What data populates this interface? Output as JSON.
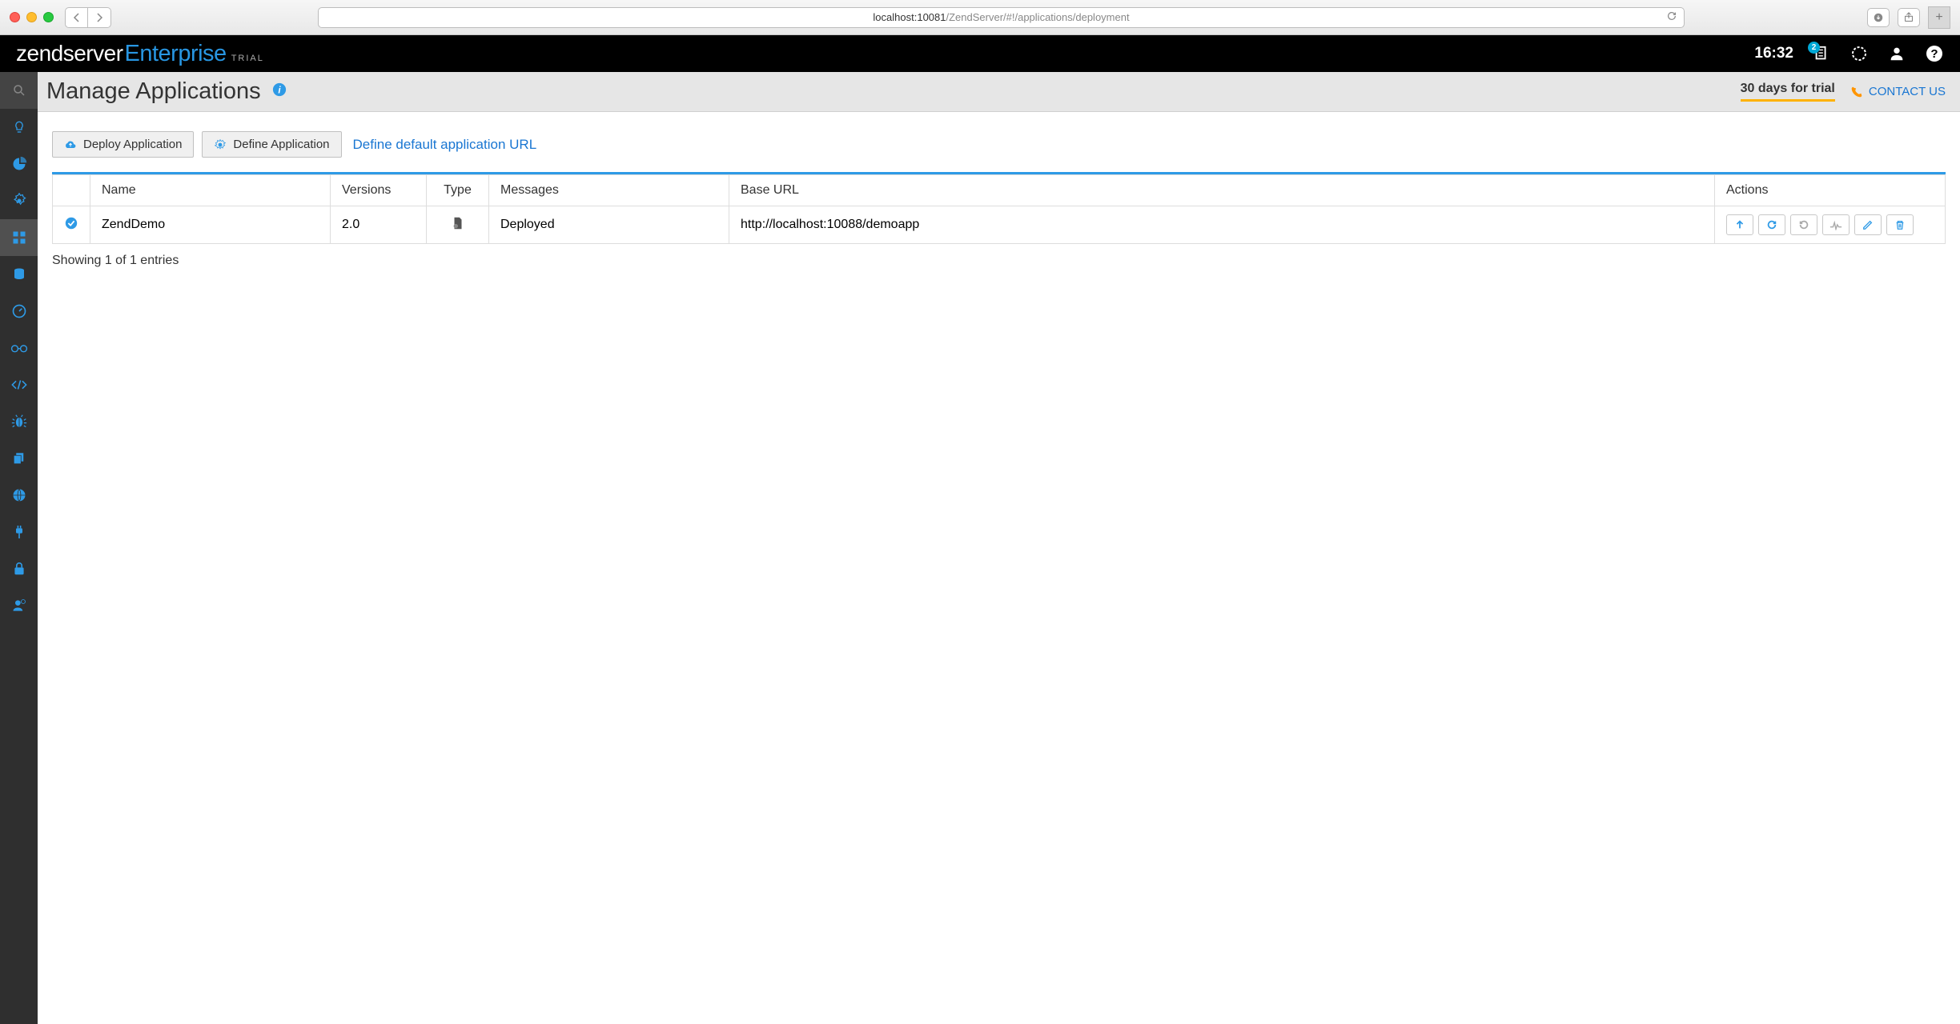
{
  "browser": {
    "url_host": "localhost:10081",
    "url_path": "/ZendServer/#!/applications/deployment"
  },
  "topbar": {
    "logo_zend": "zend",
    "logo_server": "server",
    "logo_enterprise": "Enterprise",
    "logo_trial": "TRIAL",
    "time": "16:32",
    "notif_count": "2"
  },
  "page": {
    "title": "Manage Applications",
    "trial_text": "30 days for trial",
    "contact_text": "CONTACT US"
  },
  "actions": {
    "deploy": "Deploy Application",
    "define": "Define Application",
    "default_url_link": "Define default application URL"
  },
  "table": {
    "headers": {
      "name": "Name",
      "versions": "Versions",
      "type": "Type",
      "messages": "Messages",
      "baseurl": "Base URL",
      "actions": "Actions"
    },
    "rows": [
      {
        "name": "ZendDemo",
        "version": "2.0",
        "message": "Deployed",
        "baseurl": "http://localhost:10088/demoapp"
      }
    ],
    "footer": "Showing 1 of 1 entries"
  }
}
